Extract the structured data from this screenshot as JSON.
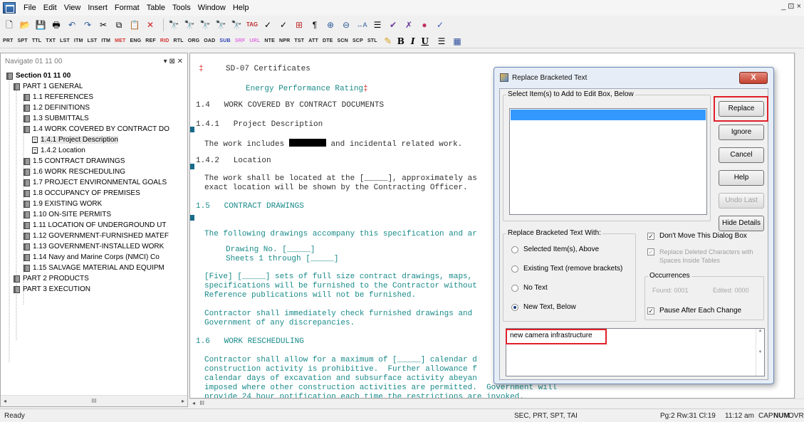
{
  "menubar": {
    "items": [
      "File",
      "Edit",
      "View",
      "Insert",
      "Format",
      "Table",
      "Tools",
      "Window",
      "Help"
    ],
    "window_controls": "_ ⊡ ×"
  },
  "toolbar2": {
    "tags": [
      "PRT",
      "SPT",
      "TTL",
      "TXT",
      "LST",
      "ITM",
      "LST",
      "ITM",
      "MET",
      "ENG",
      "REF",
      "RID",
      "RTL",
      "ORG",
      "OAD",
      "SUB",
      "SRF",
      "URL",
      "NTE",
      "NPR",
      "TST",
      "ATT",
      "DTE",
      "SCN",
      "SCP",
      "STL"
    ],
    "format": [
      "B",
      "I",
      "U"
    ]
  },
  "nav": {
    "header": "Navigate 01 11 00",
    "header_controls": "▾ ⊠ ✕",
    "scroll_mid": "III",
    "tree": [
      {
        "label": "Section 01 11 00",
        "bold": true
      },
      {
        "label": "PART 1  GENERAL"
      },
      {
        "label": "1.1  REFERENCES"
      },
      {
        "label": "1.2  DEFINITIONS"
      },
      {
        "label": "1.3  SUBMITTALS"
      },
      {
        "label": "1.4  WORK COVERED BY CONTRACT DO"
      },
      {
        "label": "1.4.1  Project Description"
      },
      {
        "label": "1.4.2  Location"
      },
      {
        "label": "1.5  CONTRACT DRAWINGS"
      },
      {
        "label": "1.6  WORK RESCHEDULING"
      },
      {
        "label": "1.7  PROJECT ENVIRONMENTAL GOALS"
      },
      {
        "label": "1.8  OCCUPANCY OF PREMISES"
      },
      {
        "label": "1.9  EXISTING WORK"
      },
      {
        "label": "1.10  ON-SITE PERMITS"
      },
      {
        "label": "1.11  LOCATION OF UNDERGROUND UT"
      },
      {
        "label": "1.12  GOVERNMENT-FURNISHED MATEF"
      },
      {
        "label": "1.13  GOVERNMENT-INSTALLED WORK"
      },
      {
        "label": "1.14  Navy and Marine Corps (NMCI) Co"
      },
      {
        "label": "1.15  SALVAGE MATERIAL AND EQUIPM"
      },
      {
        "label": "PART 2  PRODUCTS"
      },
      {
        "label": "PART 3  EXECUTION"
      }
    ]
  },
  "document": {
    "lines": [
      "SD-07 Certificates",
      "Energy Performance Rating",
      "1.4   WORK COVERED BY CONTRACT DOCUMENTS",
      "1.4.1   Project Description",
      "The work includes",
      "and incidental related work.",
      "1.4.2   Location",
      "The work shall be located at the [_____], approximately as",
      "exact location will be shown by the Contracting Officer.",
      "1.5   CONTRACT DRAWINGS",
      "The following drawings accompany this specification and ar",
      "Drawing No. [_____]",
      "Sheets 1 through [_____]",
      "[Five] [_____] sets of full size contract drawings, maps,",
      "specifications will be furnished to the Contractor without",
      "Reference publications will not be furnished.",
      "Contractor shall immediately check furnished drawings and",
      "Government of any discrepancies.",
      "1.6   WORK RESCHEDULING",
      "Contractor shall allow for a maximum of [_____] calendar d",
      "construction activity is prohibitive.  Further allowance f",
      "calendar days of excavation and subsurface activity abeyan",
      "imposed where other construction activities are permitted.  Government will",
      "provide 24 hour notification each time the restrictions are invoked."
    ],
    "scroll_mid": "III"
  },
  "dialog": {
    "title": "Replace Bracketed Text",
    "close": "X",
    "select_label": "Select Item(s) to Add to Edit Box, Below",
    "buttons": [
      "Replace",
      "Ignore",
      "Cancel",
      "Help",
      "Undo Last",
      "Hide Details"
    ],
    "replace_with_label": "Replace Bracketed Text With:",
    "radios": [
      "Selected Item(s), Above",
      "Existing Text (remove brackets)",
      "No Text",
      "New Text, Below"
    ],
    "selected_radio": 3,
    "checkboxes": {
      "dont_move": "Don't Move This Dialog Box",
      "replace_deleted": "Replace Deleted Characters with Spaces Inside Tables",
      "pause": "Pause After Each Change"
    },
    "occurrences_label": "Occurrences",
    "found": "Found: 0001",
    "edited": "Edited: 0000",
    "new_text": "new camera infrastructure",
    "highlight_color": "#e0202a"
  },
  "status": {
    "ready": "Ready",
    "tags": "SEC, PRT, SPT, TAI",
    "position": "Pg:2  Rw:31  Cl:19",
    "time": "11:12 am",
    "caps": "CAP",
    "num": "NUM",
    "ovr": "OVR"
  }
}
